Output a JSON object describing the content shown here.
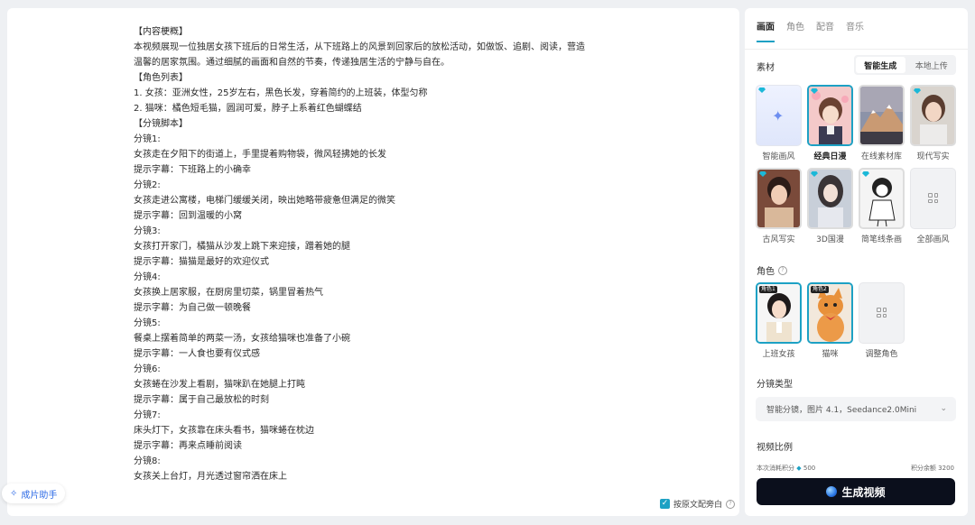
{
  "script_lines": [
    "【内容梗概】",
    "本视频展现一位独居女孩下班后的日常生活，从下班路上的风景到回家后的放松活动，如做饭、追剧、阅读，营造",
    "温馨的居家氛围。通过细腻的画面和自然的节奏，传递独居生活的宁静与自在。",
    "【角色列表】",
    "1. 女孩：亚洲女性，25岁左右，黑色长发，穿着简约的上班装，体型匀称",
    "2. 猫咪：橘色短毛猫，圆润可爱，脖子上系着红色蝴蝶结",
    "【分镜脚本】",
    "分镜1:",
    "女孩走在夕阳下的街道上，手里提着购物袋，微风轻拂她的长发",
    "提示字幕：下班路上的小确幸",
    "分镜2:",
    "女孩走进公寓楼，电梯门缓缓关闭，映出她略带疲惫但满足的微笑",
    "提示字幕：回到温暖的小窝",
    "分镜3:",
    "女孩打开家门，橘猫从沙发上跳下来迎接，蹭着她的腿",
    "提示字幕：猫猫是最好的欢迎仪式",
    "分镜4:",
    "女孩换上居家服，在厨房里切菜，锅里冒着热气",
    "提示字幕：为自己做一顿晚餐",
    "分镜5:",
    "餐桌上摆着简单的两菜一汤，女孩给猫咪也准备了小碗",
    "提示字幕：一人食也要有仪式感",
    "分镜6:",
    "女孩蜷在沙发上看剧，猫咪趴在她腿上打盹",
    "提示字幕：属于自己最放松的时刻",
    "分镜7:",
    "床头灯下，女孩靠在床头看书，猫咪蜷在枕边",
    "提示字幕：再来点睡前阅读",
    "分镜8:",
    "女孩关上台灯，月光透过窗帘洒在床上"
  ],
  "assistant_label": "成片助手",
  "voiceover_label": "按原文配旁白",
  "tabs": [
    "画面",
    "角色",
    "配音",
    "音乐"
  ],
  "material_label": "素材",
  "source_toggle": [
    "智能生成",
    "本地上传"
  ],
  "styles": [
    {
      "label": "智能画风"
    },
    {
      "label": "经典日漫"
    },
    {
      "label": "在线素材库"
    },
    {
      "label": "现代写实"
    },
    {
      "label": "古风写实"
    },
    {
      "label": "3D国漫"
    },
    {
      "label": "简笔线条画"
    },
    {
      "label": "全部画风"
    }
  ],
  "roles_label": "角色",
  "roles": [
    {
      "badge": "角色1",
      "label": "上班女孩"
    },
    {
      "badge": "角色2",
      "label": "猫咪"
    },
    {
      "label": "调整角色"
    }
  ],
  "storyboard_label": "分镜类型",
  "storyboard_value": "智能分镜，图片 4.1，Seedance2.0Mini",
  "ratio_label": "视频比例",
  "cost_label": "本次消耗积分",
  "cost_value": "500",
  "balance_label": "积分余额",
  "balance_value": "3200",
  "generate_label": "生成视频",
  "colors": {
    "accent": "#1da1c4",
    "generate_bg": "#0b0f1c",
    "assistant": "#2e6be6"
  }
}
